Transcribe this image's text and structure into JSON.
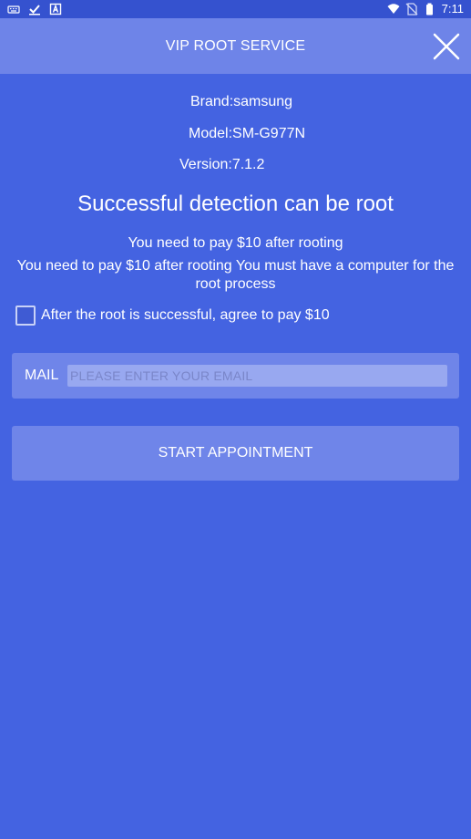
{
  "status_bar": {
    "time": "7:11",
    "left_icons": [
      "keyboard-icon",
      "check-icon",
      "a-icon"
    ],
    "right_icons": [
      "wifi-icon",
      "no-sim-icon",
      "battery-icon"
    ]
  },
  "header": {
    "title": "VIP ROOT SERVICE",
    "close_icon": "close-icon"
  },
  "device": {
    "brand": "Brand:samsung",
    "model": "Model:SM-G977N",
    "version": "Version:7.1.2"
  },
  "headline": "Successful detection can be root",
  "pay_notice": "You need to pay $10 after rooting",
  "pay_description": "You need to pay $10 after rooting You must have a computer for the root process",
  "agreement": {
    "label": "After the root is successful, agree to pay $10",
    "checked": false
  },
  "mail": {
    "label": "MAIL",
    "placeholder": "PLEASE ENTER YOUR EMAIL",
    "value": ""
  },
  "start_button": "START APPOINTMENT",
  "colors": {
    "background": "#4463e1",
    "header": "#6e84e8",
    "status_bar": "#3552cf",
    "panel": "#6f85e9"
  }
}
